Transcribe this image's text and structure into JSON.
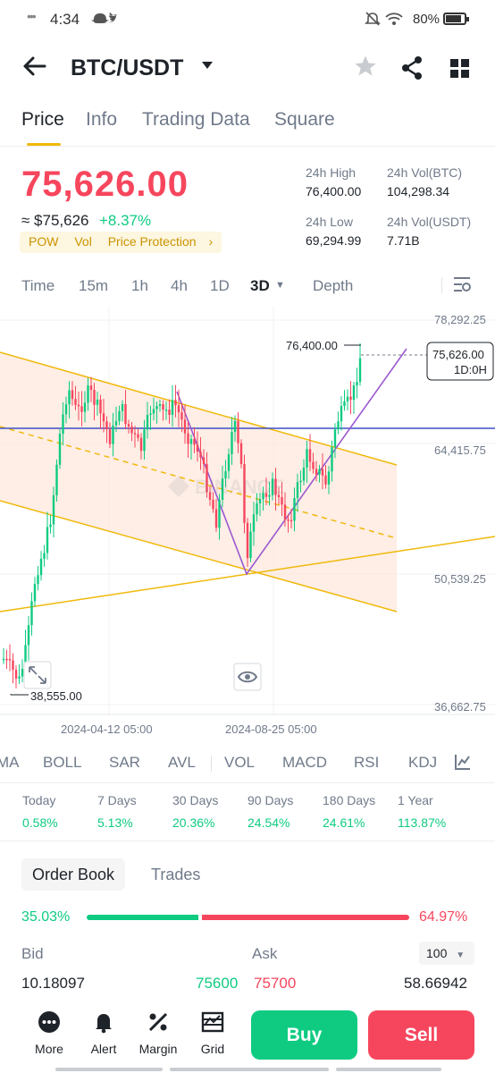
{
  "status_bar": {
    "time": "4:34",
    "battery": "80%"
  },
  "header": {
    "pair": "BTC/USDT"
  },
  "tabs": [
    {
      "label": "Price",
      "active": true
    },
    {
      "label": "Info"
    },
    {
      "label": "Trading Data"
    },
    {
      "label": "Square"
    }
  ],
  "price": {
    "last": "75,626.00",
    "approx": "≈ $75,626",
    "change": "+8.37%",
    "tags": [
      "POW",
      "Vol",
      "Price Protection"
    ],
    "stats": {
      "high_label": "24h High",
      "high": "76,400.00",
      "vol_btc_label": "24h Vol(BTC)",
      "vol_btc": "104,298.34",
      "low_label": "24h Low",
      "low": "69,294.99",
      "vol_usdt_label": "24h Vol(USDT)",
      "vol_usdt": "7.71B"
    }
  },
  "timeframes": [
    "Time",
    "15m",
    "1h",
    "4h",
    "1D",
    "3D",
    "Depth"
  ],
  "active_timeframe": "3D",
  "chart": {
    "y_labels": [
      "78,292.25",
      "64,415.75",
      "50,539.25",
      "36,662.75"
    ],
    "x_labels": [
      "2024-04-12 05:00",
      "2024-08-25 05:00"
    ],
    "high_marker": "76,400.00",
    "low_marker": "38,555.00",
    "current_price": "75,626.00",
    "current_countdown": "1D:0H",
    "colors": {
      "up": "#0ecb81",
      "down": "#f6465d",
      "channel": "#f0b90b",
      "wedge": "#9b59d0",
      "hline": "#3d4fc7"
    }
  },
  "chart_data": {
    "type": "candlestick",
    "y_axis_ticks": [
      78292.25,
      64415.75,
      50539.25,
      36662.75
    ],
    "x_axis_ticks": [
      "2024-04-12 05:00",
      "2024-08-25 05:00"
    ],
    "high": 76400.0,
    "low": 38555.0,
    "last": 75626.0
  },
  "indicators": [
    "MA",
    "BOLL",
    "SAR",
    "AVL",
    "VOL",
    "MACD",
    "RSI",
    "KDJ"
  ],
  "performance": [
    {
      "label": "Today",
      "value": "0.58%"
    },
    {
      "label": "7 Days",
      "value": "5.13%"
    },
    {
      "label": "30 Days",
      "value": "20.36%"
    },
    {
      "label": "90 Days",
      "value": "24.54%"
    },
    {
      "label": "180 Days",
      "value": "24.61%"
    },
    {
      "label": "1 Year",
      "value": "113.87%"
    }
  ],
  "order_book": {
    "tab_order_book": "Order Book",
    "tab_trades": "Trades",
    "bid_pct": "35.03%",
    "ask_pct": "64.97%",
    "bid_share": 0.3503,
    "bid_label": "Bid",
    "ask_label": "Ask",
    "depth": "100",
    "bid_qty": "10.18097",
    "bid_price": "75600",
    "ask_price": "75700",
    "ask_qty": "58.66942"
  },
  "bottom_bar": {
    "items": [
      "More",
      "Alert",
      "Margin",
      "Grid"
    ],
    "buy": "Buy",
    "sell": "Sell"
  }
}
